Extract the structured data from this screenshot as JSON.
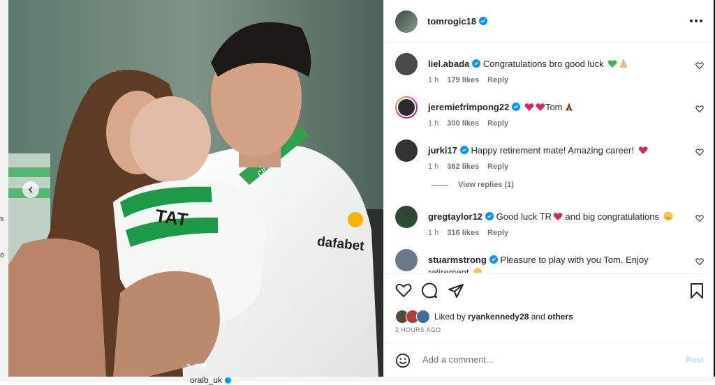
{
  "background": {
    "side_letters": [
      "s",
      "o"
    ],
    "bottom_username": "oralb_uk"
  },
  "post": {
    "username": "tomrogic18",
    "verified": true,
    "image": {
      "description_icon": "photo-image",
      "jersey_text_1": "dafabet",
      "jersey_text_2": "cinch",
      "jersey_text_3": "TAT",
      "carousel_count": 3,
      "carousel_active": 3
    }
  },
  "comments": [
    {
      "user": "liel.abada",
      "verified": true,
      "text": "Congratulations bro good luck ",
      "emoji": [
        "green-heart",
        "folded-hands"
      ],
      "time": "1 h",
      "likes": "179 likes",
      "reply": "Reply",
      "avatar_color": "#4a4a4a"
    },
    {
      "user": "jeremiefrimpong22",
      "verified": true,
      "text": "Tom",
      "emoji_before": [
        "red-heart",
        "red-heart"
      ],
      "emoji": [
        "folded-hands-dark"
      ],
      "time": "1 h",
      "likes": "300 likes",
      "reply": "Reply",
      "avatar_color": "#2b2b2b"
    },
    {
      "user": "jurki17",
      "verified": true,
      "text": "Happy retirement mate! Amazing career! ",
      "emoji": [
        "red-heart"
      ],
      "time": "1 h",
      "likes": "362 likes",
      "reply": "Reply",
      "avatar_color": "#333333"
    },
    {
      "user": "gregtaylor12",
      "verified": true,
      "text": "Good luck TR",
      "text_after": " and big congratulations ",
      "emoji": [
        "red-heart",
        "clapping-face"
      ],
      "time": "1 h",
      "likes": "316 likes",
      "reply": "Reply",
      "avatar_color": "#1f5c2c"
    },
    {
      "user": "stuarmstrong",
      "verified": true,
      "text": "Pleasure to play with you Tom. Enjoy retirement ",
      "emoji": [
        "hugging-face"
      ],
      "avatar_color": "#6b7a8a"
    }
  ],
  "view_replies": "View replies (1)",
  "actions": {
    "icons": [
      "heart-icon",
      "comment-icon",
      "share-icon",
      "bookmark-icon"
    ]
  },
  "liked_by": {
    "prefix": "Liked by ",
    "user": "ryankennedy28",
    "middle": " and ",
    "suffix": "others"
  },
  "timestamp": "2 HOURS AGO",
  "add_comment": {
    "placeholder": "Add a comment...",
    "post_label": "Post"
  },
  "colors": {
    "verified_blue": "#0095f6",
    "post_disabled": "#b2dffc",
    "meta_gray": "#737373",
    "celtic_green": "#1d9a47"
  }
}
